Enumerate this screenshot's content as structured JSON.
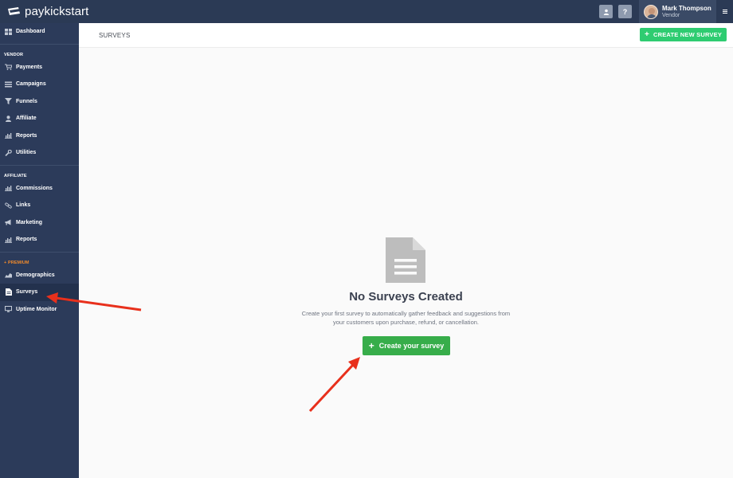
{
  "brand": {
    "name_light": "pay",
    "name_bold": "kick",
    "name_rest": "start"
  },
  "topbar": {
    "user_btn_icon": "user-icon",
    "help_label": "?",
    "user_name": "Mark Thompson",
    "user_role": "Vendor",
    "menu_icon": "menu-icon"
  },
  "sidebar": {
    "dashboard": "Dashboard",
    "vendor_title": "VENDOR",
    "vendor_items": [
      "Payments",
      "Campaigns",
      "Funnels",
      "Affiliate",
      "Reports",
      "Utilities"
    ],
    "affiliate_title": "AFFILIATE",
    "affiliate_items": [
      "Commissions",
      "Links",
      "Marketing",
      "Reports"
    ],
    "premium_title": "+ PREMIUM",
    "premium_items": [
      "Demographics",
      "Surveys",
      "Uptime Monitor"
    ]
  },
  "header": {
    "title": "SURVEYS",
    "create_button": "CREATE NEW SURVEY"
  },
  "empty_state": {
    "title": "No Surveys Created",
    "desc_line1": "Create your first survey to automatically gather feedback and suggestions from",
    "desc_line2": "your customers upon purchase, refund, or cancellation.",
    "button": "Create your survey"
  },
  "colors": {
    "topbar": "#2b3a55",
    "sidebar": "#2c3b5a",
    "accent_green": "#2ecc71",
    "button_green": "#37ad4a",
    "premium_orange": "#f08a2c",
    "annotation_red": "#e8301c"
  }
}
